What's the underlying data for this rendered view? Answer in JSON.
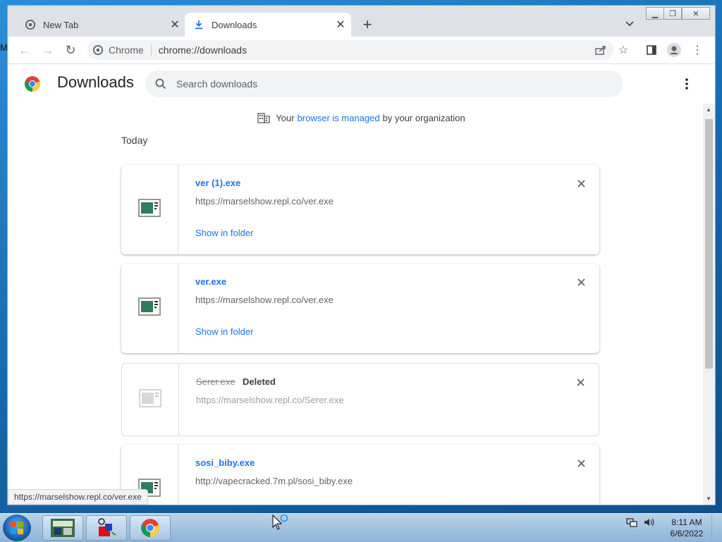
{
  "desktop": {
    "edge_letter": "M"
  },
  "tabs": [
    {
      "label": "New Tab",
      "active": false
    },
    {
      "label": "Downloads",
      "active": true
    }
  ],
  "toolbar": {
    "site_label": "Chrome",
    "url": "chrome://downloads"
  },
  "page": {
    "title": "Downloads",
    "search_placeholder": "Search downloads"
  },
  "managed_notice": {
    "prefix": "Your",
    "link": "browser is managed",
    "suffix": "by your organization"
  },
  "section_label": "Today",
  "downloads": [
    {
      "filename": "ver (1).exe",
      "url": "https://marselshow.repl.co/ver.exe",
      "action": "Show in folder",
      "status": ""
    },
    {
      "filename": "ver.exe",
      "url": "https://marselshow.repl.co/ver.exe",
      "action": "Show in folder",
      "status": ""
    },
    {
      "filename": "Serer.exe",
      "url": "https://marselshow.repl.co/Serer.exe",
      "action": "",
      "status": "Deleted"
    },
    {
      "filename": "sosi_biby.exe",
      "url": "http://vapecracked.7m.pl/sosi_biby.exe",
      "action": "",
      "status": ""
    }
  ],
  "status_bubble": "https://marselshow.repl.co/ver.exe",
  "taskbar": {
    "time": "8:11 AM",
    "date": "6/6/2022"
  },
  "colors": {
    "link": "#1a73e8",
    "tabstrip": "#dee1e6"
  }
}
